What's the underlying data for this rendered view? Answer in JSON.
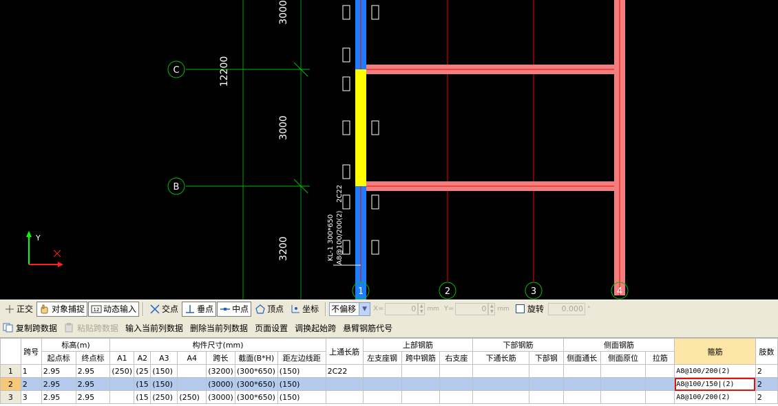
{
  "canvas": {
    "axis_labels": {
      "c": "C",
      "b": "B",
      "n1": "1",
      "n2": "2",
      "n3": "3",
      "n4": "4"
    },
    "dim_labels": {
      "top": "3000",
      "mid": "3000",
      "big": "12200",
      "low": "3200"
    },
    "beam_annotation": {
      "line1": "2C22",
      "line2": "KL-1  300*650",
      "line3": "A8@100/200(2)"
    },
    "ucs": {
      "y": "Y",
      "x": "X"
    },
    "colors": {
      "grid": "#00c000",
      "axisLine": "#ff0000",
      "column": "#1e7cff",
      "beamFill": "#f08080",
      "selected": "#ffff00"
    }
  },
  "snapbar": {
    "ortho": "正交",
    "objsnap": "对象捕捉",
    "dyninput": "动态输入",
    "intersect": "交点",
    "perp": "垂点",
    "mid": "中点",
    "vertex": "顶点",
    "coord": "坐标",
    "offset_select": "不偏移",
    "x_label": "X=",
    "x_value": "0",
    "y_label": "Y=",
    "y_value": "0",
    "unit": "mm",
    "rotate": "旋转",
    "rotate_value": "0.000",
    "deg": "°"
  },
  "toolbar2": {
    "copy_span": "复制跨数据",
    "paste_span": "粘贴跨数据",
    "input_col": "输入当前列数据",
    "delete_col": "删除当前列数据",
    "page_setup": "页面设置",
    "swap_start": "调换起始跨",
    "cantilever": "悬臂钢筋代号"
  },
  "grid": {
    "headers": {
      "span": "跨号",
      "elev": "标高(m)",
      "elev_start": "起点标",
      "elev_end": "终点标",
      "dims": "构件尺寸(mm)",
      "a1": "A1",
      "a2": "A2",
      "a3": "A3",
      "a4": "A4",
      "span_len": "跨长",
      "section": "截面(B*H)",
      "edge_dist": "距左边线距",
      "top_through": "上通长筋",
      "top_rebar": "上部钢筋",
      "left_support": "左支座钢",
      "mid_span": "跨中钢筋",
      "right_support": "右支座",
      "bottom_rebar": "下部钢筋",
      "bot_through": "下通长筋",
      "bot_rebar": "下部钢",
      "side_rebar": "侧面钢筋",
      "side_through": "侧面通长",
      "side_orig": "侧面原位",
      "tie": "拉筋",
      "stirrup": "箍筋",
      "legs": "肢数"
    },
    "rows": [
      {
        "rn": "1",
        "span": "1",
        "start": "2.95",
        "end": "2.95",
        "a1": "(250)",
        "a2": "(25",
        "a3": "(150)",
        "a4": "",
        "len": "(3200)",
        "sec": "(300*650)",
        "edge": "(150)",
        "top": "2C22",
        "stirrup": "A8@100/200(2)",
        "legs": "2"
      },
      {
        "rn": "2",
        "span": "2",
        "start": "2.95",
        "end": "2.95",
        "a1": "",
        "a2": "(15",
        "a3": "(150)",
        "a4": "",
        "len": "(3000)",
        "sec": "(300*650)",
        "edge": "(150)",
        "top": "",
        "stirrup": "A8@100/150|(2)",
        "legs": "2"
      },
      {
        "rn": "3",
        "span": "3",
        "start": "2.95",
        "end": "2.95",
        "a1": "",
        "a2": "(15",
        "a3": "(250)",
        "a4": "(250)",
        "len": "(3000)",
        "sec": "(300*650)",
        "edge": "(150)",
        "top": "",
        "stirrup": "A8@100/200(2)",
        "legs": "2"
      }
    ]
  }
}
